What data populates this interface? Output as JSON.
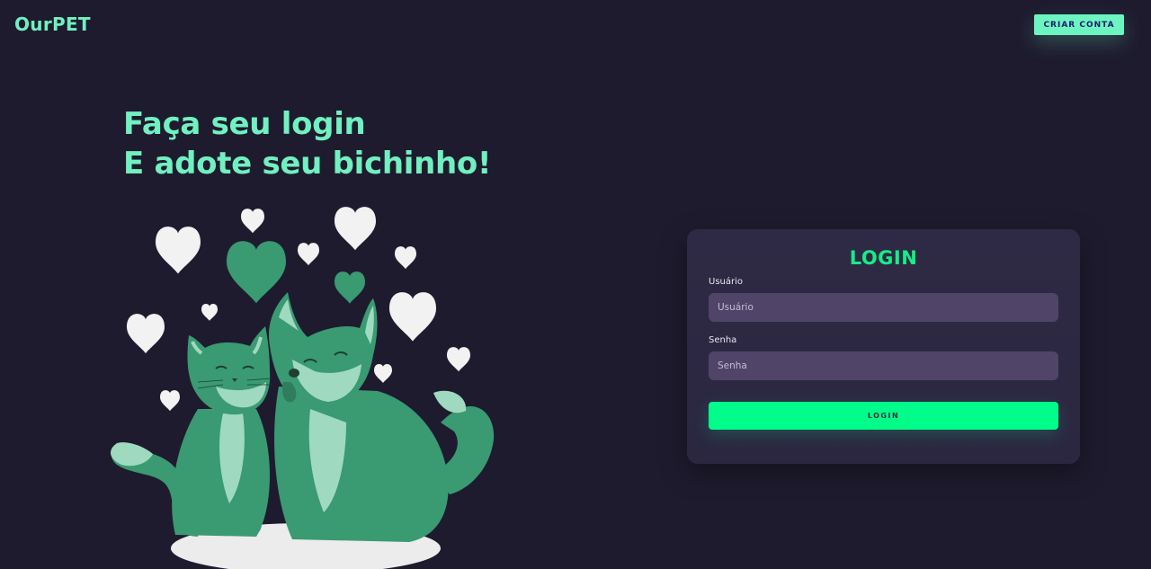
{
  "header": {
    "logo": "OurPET",
    "signup_label": "CRIAR CONTA"
  },
  "hero": {
    "line1": "Faça seu login",
    "line2": "E adote seu bichinho!"
  },
  "login_card": {
    "title": "LOGIN",
    "username_label": "Usuário",
    "username_placeholder": "Usuário",
    "password_label": "Senha",
    "password_placeholder": "Senha",
    "submit_label": "LOGIN"
  },
  "colors": {
    "background": "#1e1b2e",
    "accent_mint": "#71f0c0",
    "accent_green": "#00fd8a",
    "pet_green": "#3a9a72",
    "card": "#2e2a45",
    "input": "#504568"
  },
  "illustration": {
    "subject": "cat-and-dog-with-hearts"
  }
}
